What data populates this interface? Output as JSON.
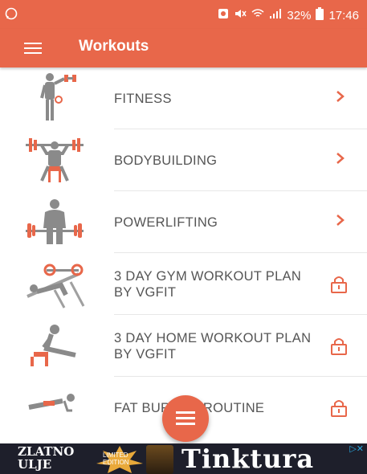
{
  "status_bar": {
    "battery_percent": "32%",
    "time": "17:46",
    "icons": [
      "whatsapp-icon",
      "sim-icon",
      "mute-icon",
      "wifi-icon",
      "signal-icon",
      "battery-icon"
    ]
  },
  "app_bar": {
    "title": "Workouts",
    "menu_icon": "hamburger-icon"
  },
  "workouts": [
    {
      "label": "FITNESS",
      "icon": "dumbbell-man-icon",
      "action": "chevron-right"
    },
    {
      "label": "BODYBUILDING",
      "icon": "bench-press-icon",
      "action": "chevron-right"
    },
    {
      "label": "POWERLIFTING",
      "icon": "deadlift-icon",
      "action": "chevron-right"
    },
    {
      "label": "3 DAY GYM WORKOUT PLAN BY VGFIT",
      "icon": "incline-bench-icon",
      "action": "lock"
    },
    {
      "label": "3 DAY HOME WORKOUT PLAN BY VGFIT",
      "icon": "dips-icon",
      "action": "lock"
    },
    {
      "label": "FAT BURNER ROUTINE",
      "icon": "plank-icon",
      "action": "lock"
    }
  ],
  "fab": {
    "icon": "menu-icon"
  },
  "ad": {
    "brand": "ZLATNO ULJE",
    "edition": "LIMITED EDITION",
    "headline": "Tinktura",
    "adchoices_icon": "ad-choices-icon"
  },
  "colors": {
    "accent": "#e8674a",
    "text": "#555555",
    "ad_bg": "#1e1f2b"
  }
}
